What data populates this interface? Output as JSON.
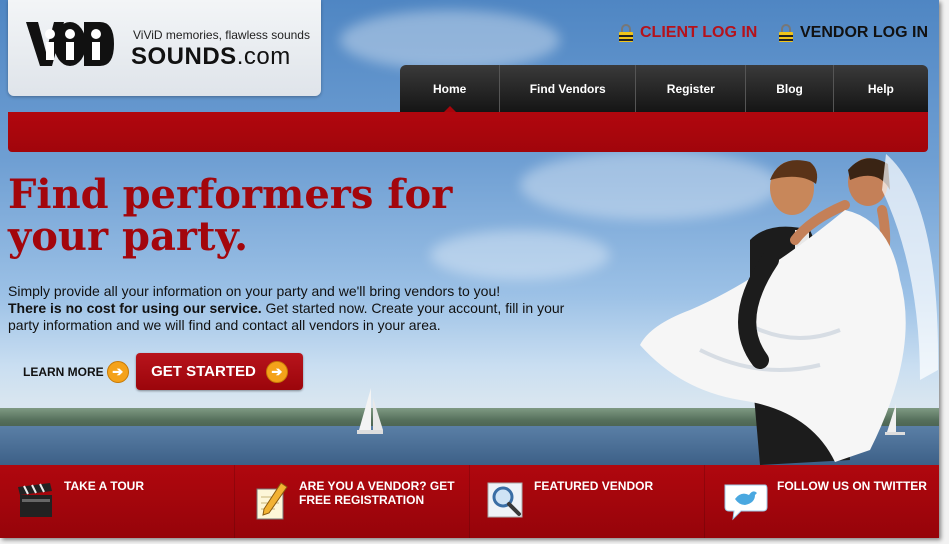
{
  "logo": {
    "tagline": "ViViD memories, flawless sounds",
    "name_bold": "SOUNDS",
    "name_suffix": ".com"
  },
  "login": {
    "client": "CLIENT LOG IN",
    "vendor": "VENDOR LOG IN"
  },
  "nav": {
    "items": [
      "Home",
      "Find Vendors",
      "Register",
      "Blog",
      "Help"
    ],
    "active": "Home"
  },
  "hero": {
    "headline": "Find performers for your party.",
    "line1": "Simply provide all your information on your party and we'll bring vendors to you!",
    "bold": "There is no cost for using our service.",
    "line2": " Get started now. Create your account, fill in your party information and we will find and contact all vendors in your area.",
    "learn_more": "LEARN MORE",
    "get_started": "GET STARTED"
  },
  "bottom": {
    "items": [
      {
        "label": "TAKE A TOUR",
        "icon": "clapperboard-icon"
      },
      {
        "label": "ARE YOU A VENDOR? GET FREE REGISTRATION",
        "icon": "notepad-pencil-icon"
      },
      {
        "label": "FEATURED VENDOR",
        "icon": "magnifier-icon"
      },
      {
        "label": "FOLLOW US ON TWITTER",
        "icon": "twitter-bird-icon"
      }
    ]
  },
  "colors": {
    "brand_red": "#a3060c",
    "nav_dark": "#1e1e1e",
    "button_orange": "#f4a21a"
  }
}
